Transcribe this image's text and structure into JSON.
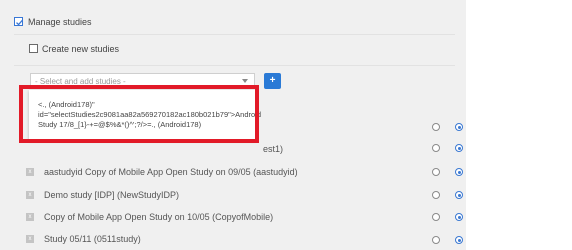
{
  "manage": {
    "label": "Manage studies",
    "checked": true
  },
  "create": {
    "label": "Create new studies",
    "checked": false
  },
  "select": {
    "placeholder": "- Select and add studies -",
    "add_label": "+"
  },
  "dropdown_option": "<., (Android178)\"\nid=\"selectStudies2c9081aa82a569270182ac180b021b79\">Android\nStudy 17/8_[1}-+=@$%&*()^';?/>=., (Android178)",
  "studies": [
    {
      "name": "",
      "tail": "est1)",
      "selected": "right"
    },
    {
      "name": "aastudyid Copy of Mobile App Open Study on 09/05 (aastudyid)",
      "selected": "right"
    },
    {
      "name": "Demo study [IDP] (NewStudyIDP)",
      "selected": "right"
    },
    {
      "name": "Copy of Mobile App Open Study on 10/05 (CopyofMobile)",
      "selected": "right"
    },
    {
      "name": "Study 05/11 (0511study)",
      "selected": "right"
    }
  ],
  "remove_label": "x",
  "colors": {
    "accent": "#2a7ad6",
    "highlight": "#e21a28"
  }
}
